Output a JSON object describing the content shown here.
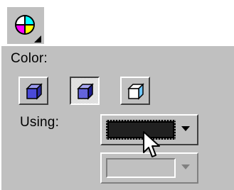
{
  "toolbar": {
    "color_button_icon": "color-wheel-icon"
  },
  "panel": {
    "color_label": "Color:",
    "using_label": "Using:",
    "style_buttons": [
      {
        "icon": "solid-cube-icon",
        "state": "normal"
      },
      {
        "icon": "dithered-cube-icon",
        "state": "pressed"
      },
      {
        "icon": "outline-cube-icon",
        "state": "normal"
      }
    ],
    "using_dropdown": {
      "selected_color": "#202020"
    },
    "second_dropdown": {
      "selected_color": "#c0c0c0",
      "enabled": false
    }
  },
  "colors": {
    "panel_background": "#c0c0c0",
    "cube_fill": "#4a4ad8",
    "cube_top": "#9a9af0",
    "cube_outline_side": "#6fc6ff"
  }
}
